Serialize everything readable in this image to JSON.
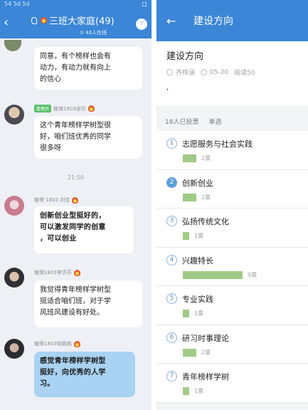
{
  "chat": {
    "status_left": "54 5d 5d",
    "status_right": "口",
    "title": "三班大家庭(49)",
    "subtitle": "43人在线",
    "messages": [
      {
        "text": "同意，有个榜样也会有\n动力，有动力就有向上\n的信心"
      },
      {
        "role": "管理员",
        "sender": "植保1803张珍",
        "text": "这个青年榜样学树型很\n好，咱们班优秀的同学\n很多呀"
      },
      {
        "sender": "植保 1803 刘佳",
        "text": "创新创业型挺好的，\n可以激发同学的创意\n，可以创业"
      },
      {
        "sender": "植保1803李洪芬",
        "text": "我觉得青年榜样学树型\n挺适合咱们班，对于学\n风班风建设有好处。"
      },
      {
        "sender": "植保1803徐鹏帆",
        "text": "感觉青年榜样学树型\n挺好，向优秀的人学\n习。"
      }
    ],
    "timestamp": "21:50"
  },
  "poll": {
    "header_title": "建设方向",
    "title": "建设方向",
    "author": "齐梓涵",
    "date": "05-20",
    "reads": "阅读50",
    "body": ",",
    "voted": "18人已投票",
    "mode": "单选",
    "options": [
      {
        "num": "1",
        "label": "志愿服务与社会实践",
        "votes": 2,
        "count_text": "2票",
        "selected": false
      },
      {
        "num": "2",
        "label": "创新创业",
        "votes": 2,
        "count_text": "2票",
        "selected": true
      },
      {
        "num": "3",
        "label": "弘扬传统文化",
        "votes": 1,
        "count_text": "1票",
        "selected": false
      },
      {
        "num": "4",
        "label": "兴趣特长",
        "votes": 9,
        "count_text": "9票",
        "selected": false
      },
      {
        "num": "5",
        "label": "专业实践",
        "votes": 1,
        "count_text": "1票",
        "selected": false
      },
      {
        "num": "6",
        "label": "研习时事理论",
        "votes": 2,
        "count_text": "2票",
        "selected": false
      },
      {
        "num": "7",
        "label": "青年榜样学树",
        "votes": 1,
        "count_text": "1票",
        "selected": false
      }
    ],
    "colors": {
      "header": "#3b86d6",
      "bar": "#9fcb86",
      "selected": "#5c9fd9"
    }
  }
}
